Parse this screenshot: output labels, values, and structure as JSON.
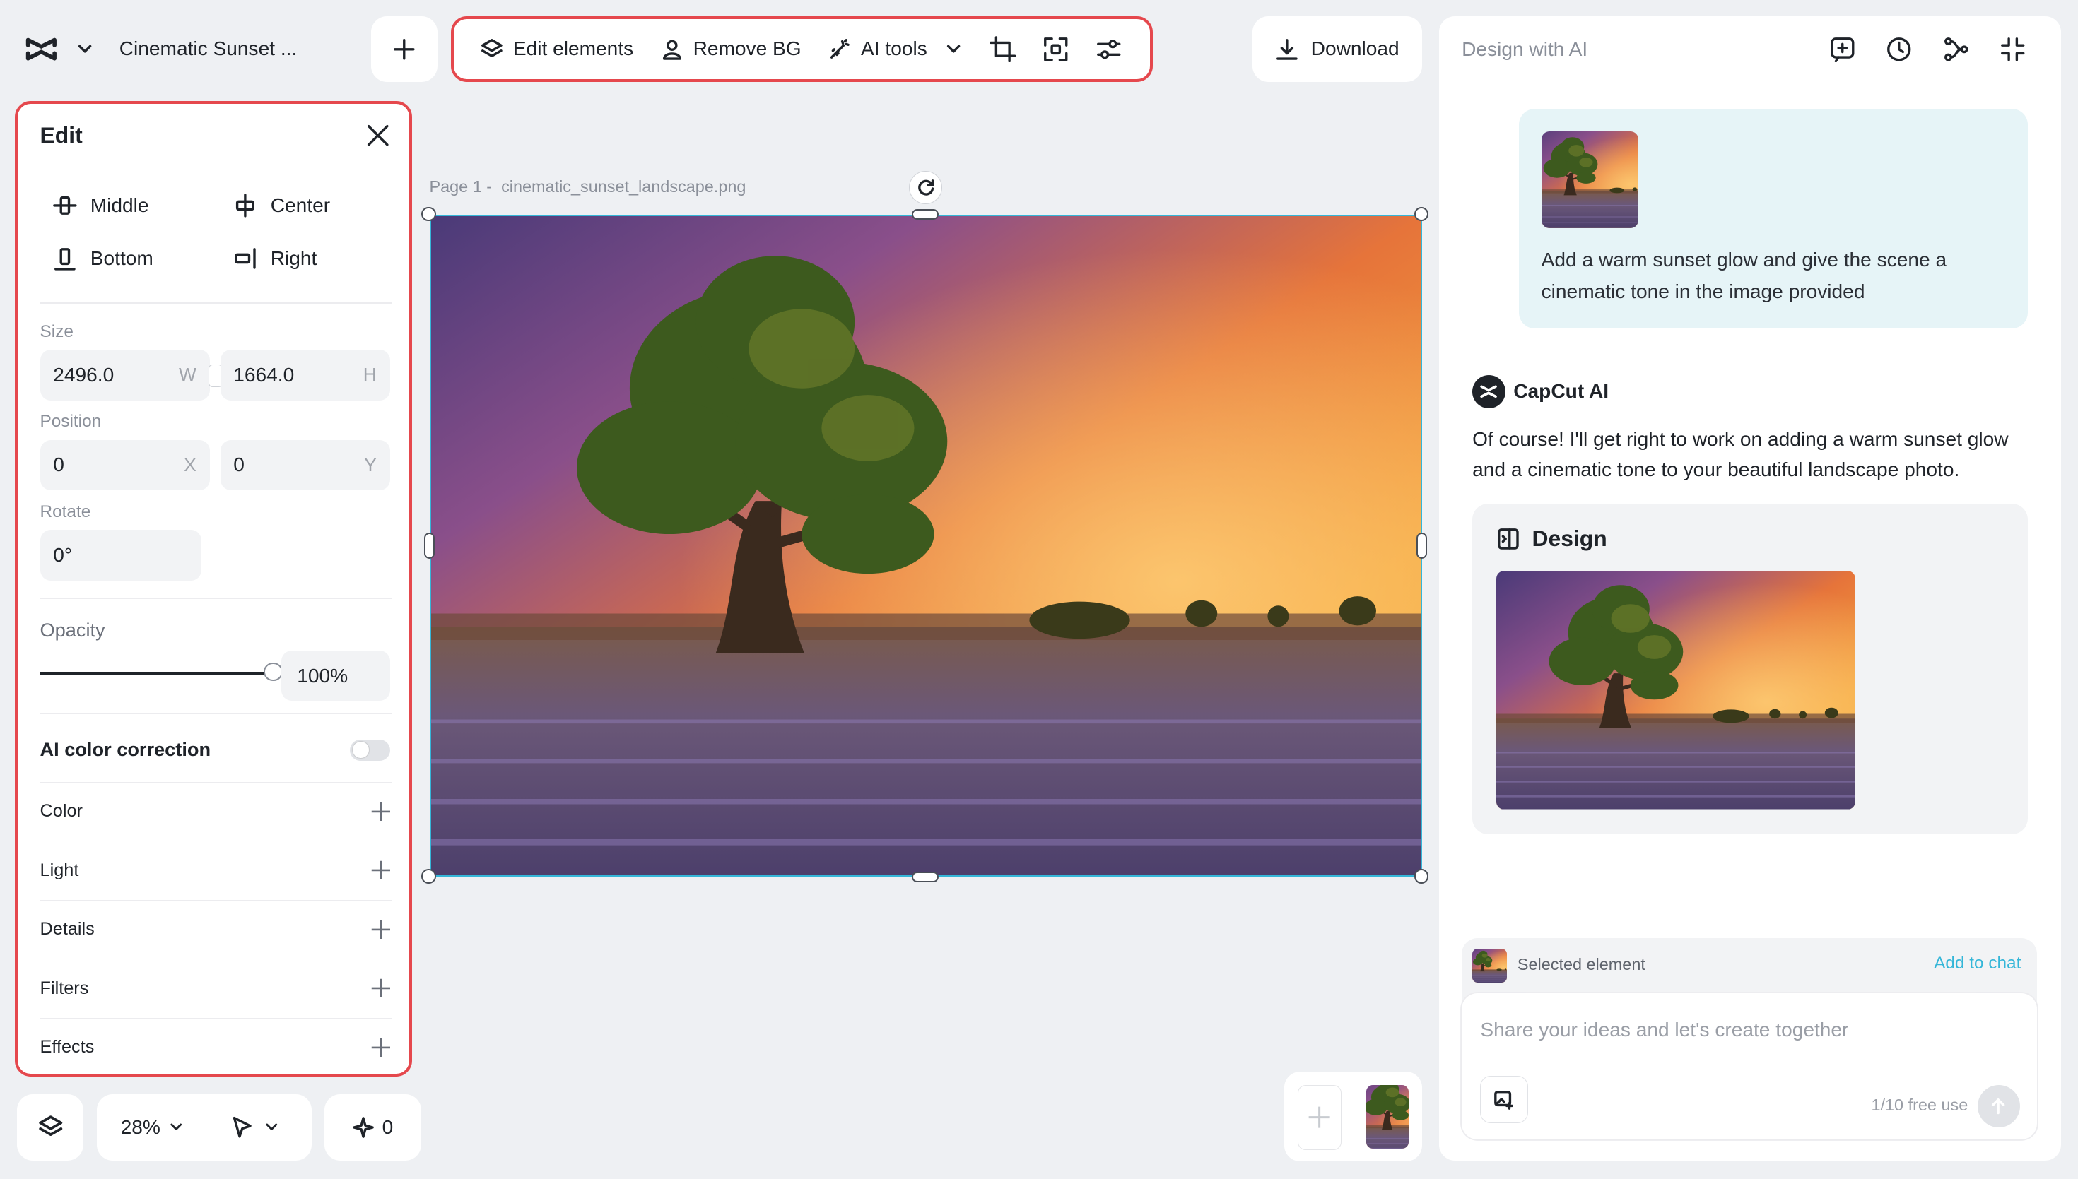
{
  "header": {
    "project_title": "Cinematic Sunset ...",
    "toolbar": {
      "edit_elements": "Edit elements",
      "remove_bg": "Remove BG",
      "ai_tools": "AI tools"
    },
    "download": "Download"
  },
  "edit_panel": {
    "title": "Edit",
    "align": {
      "middle": "Middle",
      "center": "Center",
      "bottom": "Bottom",
      "right": "Right"
    },
    "size_label": "Size",
    "width_value": "2496.0",
    "width_unit": "W",
    "height_value": "1664.0",
    "height_unit": "H",
    "position_label": "Position",
    "x_value": "0",
    "x_unit": "X",
    "y_value": "0",
    "y_unit": "Y",
    "rotate_label": "Rotate",
    "rotate_value": "0°",
    "opacity_label": "Opacity",
    "opacity_value": "100%",
    "opacity_level": 1.0,
    "ai_color_label": "AI color correction",
    "ai_color_enabled": false,
    "sections": [
      "Color",
      "Light",
      "Details",
      "Filters",
      "Effects"
    ]
  },
  "canvas": {
    "page_prefix": "Page 1 -",
    "file_name": "cinematic_sunset_landscape.png"
  },
  "bottom_bar": {
    "zoom": "28%",
    "ai_count": "0"
  },
  "right_panel": {
    "title": "Design with AI",
    "user_message": "Add a warm sunset glow and give the scene a cinematic tone in the image provided",
    "ai_name": "CapCut AI",
    "ai_message": "Of course! I'll get right to work on adding a warm sunset glow and a cinematic tone to your beautiful landscape photo.",
    "design_label": "Design",
    "selected_element_label": "Selected element",
    "add_to_chat": "Add to chat",
    "input_placeholder": "Share your ideas and let's create together",
    "free_use": "1/10 free use"
  },
  "colors": {
    "accent": "#34b6d8",
    "highlight_border": "#e5484d",
    "user_bubble": "#e6f4f7"
  }
}
